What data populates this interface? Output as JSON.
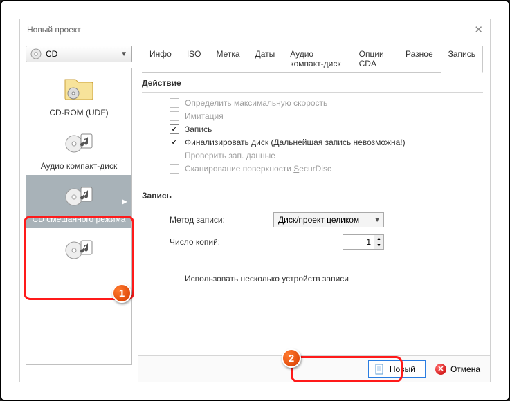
{
  "window": {
    "title": "Новый проект"
  },
  "dropdown": {
    "value": "CD"
  },
  "sidebar": {
    "items": [
      {
        "label": "CD-ROM (UDF)"
      },
      {
        "label": "Аудио компакт-диск"
      },
      {
        "label": "CD смешанного режима"
      }
    ]
  },
  "tabs": {
    "items": [
      {
        "label": "Инфо"
      },
      {
        "label": "ISO"
      },
      {
        "label": "Метка"
      },
      {
        "label": "Даты"
      },
      {
        "label": "Аудио компакт-диск"
      },
      {
        "label": "Опции CDA"
      },
      {
        "label": "Разное"
      },
      {
        "label": "Запись"
      }
    ],
    "active": 7
  },
  "sections": {
    "action": {
      "title": "Действие"
    },
    "write": {
      "title": "Запись"
    }
  },
  "checks": {
    "det_speed": {
      "label": "Определить максимальную скорость",
      "checked": false,
      "enabled": false
    },
    "simulate": {
      "label": "Имитация",
      "checked": false,
      "enabled": false
    },
    "write": {
      "label": "Запись",
      "checked": true,
      "enabled": true
    },
    "finalize": {
      "label": "Финализировать диск (Дальнейшая запись невозможна!)",
      "checked": true,
      "enabled": true
    },
    "verify": {
      "label": "Проверить зап. данные",
      "checked": false,
      "enabled": false
    },
    "securdisc": {
      "label_pre": "Сканирование поверхности ",
      "label_u": "S",
      "label_post": "ecurDisc",
      "checked": false,
      "enabled": false
    },
    "multi": {
      "label": "Использовать несколько устройств записи",
      "checked": false,
      "enabled": true
    }
  },
  "form": {
    "method_label": "Метод записи:",
    "method_value": "Диск/проект целиком",
    "copies_label": "Число копий:",
    "copies_value": "1"
  },
  "buttons": {
    "new": "Новый",
    "cancel": "Отмена"
  }
}
